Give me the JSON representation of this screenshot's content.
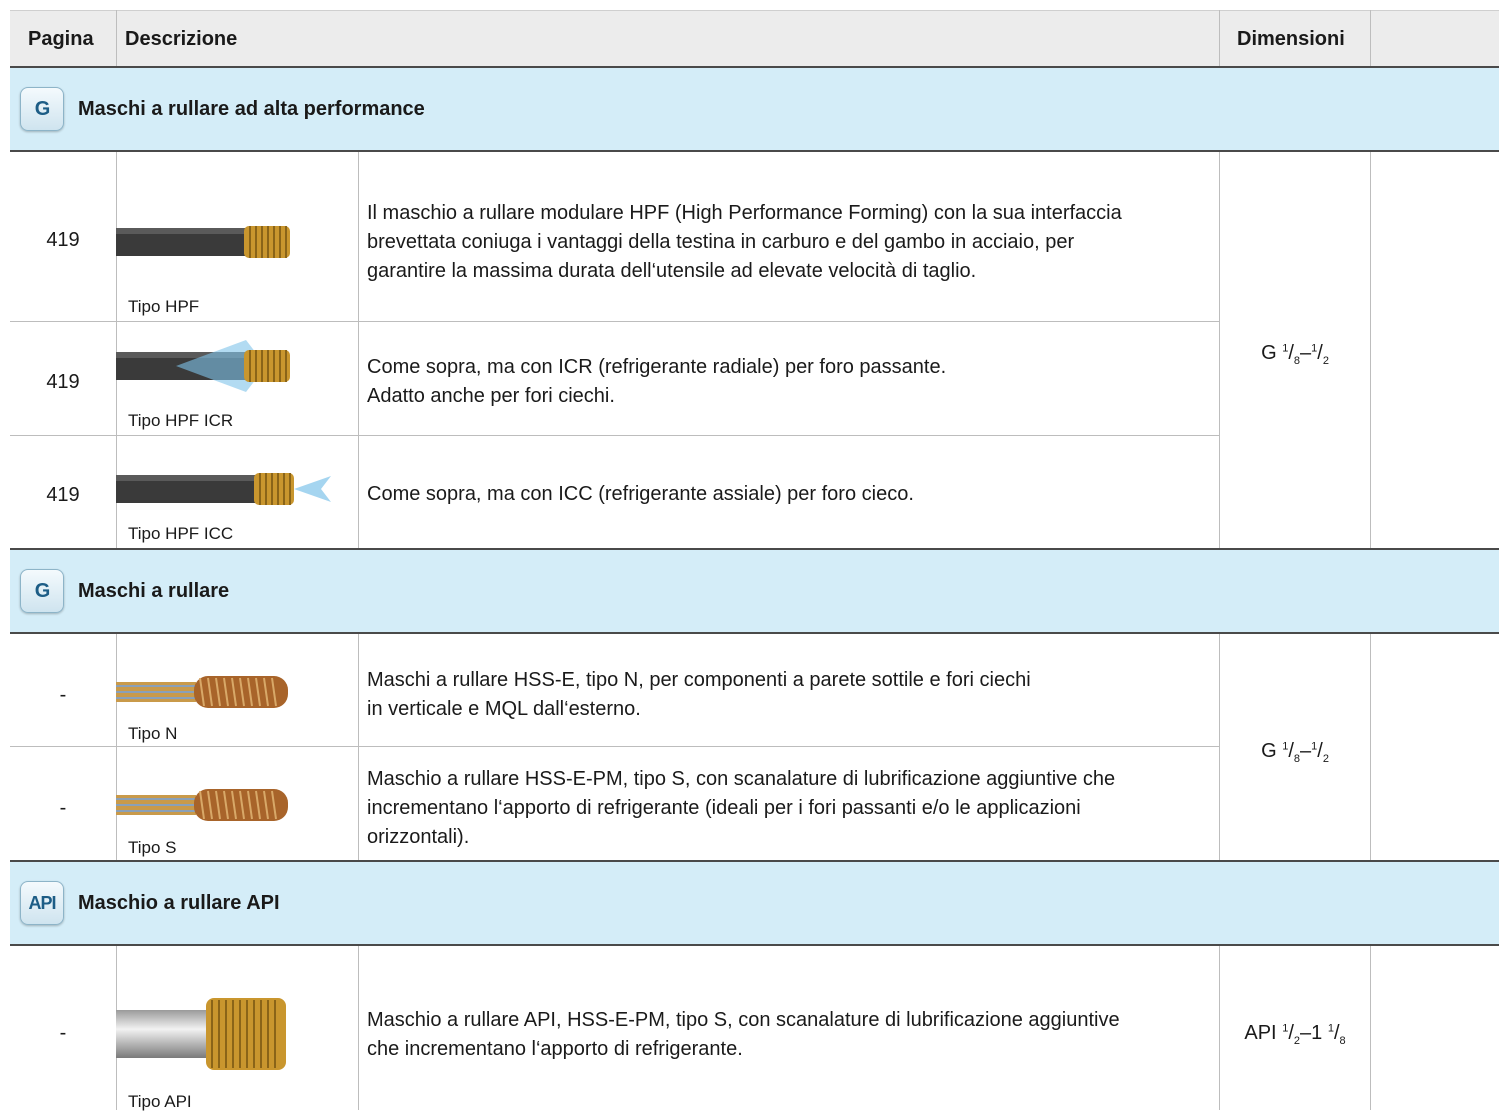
{
  "header": {
    "col_page": "Pagina",
    "col_desc": "Descrizione",
    "col_dim": "Dimensioni"
  },
  "sections": [
    {
      "badge": "G",
      "title": "Maschi a rullare ad alta performance",
      "rows": [
        {
          "page": "419",
          "type": "Tipo HPF",
          "tool_icon": "hpf-tap-icon",
          "description": [
            "Il maschio a rullare modulare HPF (High Performance Forming) con la sua interfaccia",
            "brevettata coniuga i vantaggi della testina in carburo e del gambo in acciaio, per",
            "garantire la massima durata dell‘utensile ad elevate velocità di taglio."
          ]
        },
        {
          "page": "419",
          "type": "Tipo HPF ICR",
          "tool_icon": "hpf-icr-tap-icon",
          "description": [
            "Come sopra, ma con ICR (refrigerante radiale) per foro passante.",
            "Adatto anche per fori ciechi."
          ]
        },
        {
          "page": "419",
          "type": "Tipo HPF ICC",
          "tool_icon": "hpf-icc-tap-icon",
          "description": [
            "Come sopra, ma con ICC (refrigerante assiale) per foro cieco."
          ]
        }
      ],
      "dimension": {
        "prefix": "G",
        "from_num": "1",
        "from_den": "8",
        "to_num": "1",
        "to_den": "2"
      }
    },
    {
      "badge": "G",
      "title": "Maschi a rullare",
      "rows": [
        {
          "page": "-",
          "type": "Tipo N",
          "tool_icon": "roll-tap-n-icon",
          "description": [
            "Maschi a rullare HSS-E, tipo N, per componenti a parete sottile e fori ciechi",
            "in verticale e MQL dall‘esterno."
          ]
        },
        {
          "page": "-",
          "type": "Tipo S",
          "tool_icon": "roll-tap-s-icon",
          "description": [
            "Maschio a rullare HSS-E-PM, tipo S, con scanalature di lubrificazione aggiuntive che",
            "incrementano l‘apporto di refrigerante (ideali per i fori passanti e/o le applicazioni",
            "orizzontali)."
          ]
        }
      ],
      "dimension": {
        "prefix": "G",
        "from_num": "1",
        "from_den": "8",
        "to_num": "1",
        "to_den": "2"
      }
    },
    {
      "badge": "API",
      "title": "Maschio a rullare API",
      "rows": [
        {
          "page": "-",
          "type": "Tipo API",
          "tool_icon": "api-tap-icon",
          "description": [
            "Maschio a rullare API, HSS-E-PM, tipo S, con scanalature di lubrificazione aggiuntive",
            "che incrementano l‘apporto di refrigerante."
          ]
        }
      ],
      "dimension": {
        "prefix": "API",
        "from_num": "1",
        "from_den": "2",
        "to_whole": "1",
        "to_num": "1",
        "to_den": "8"
      }
    }
  ],
  "colors": {
    "header_bg": "#ececec",
    "section_bg": "#d4edf8",
    "badge_text": "#1d5d86",
    "gold": "#c9962e",
    "shank": "#3a3a3a"
  }
}
